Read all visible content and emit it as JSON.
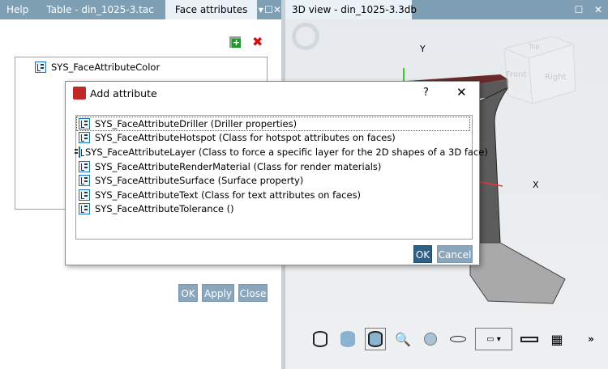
{
  "left_panel": {
    "tabs": [
      {
        "label": "Help"
      },
      {
        "label": "Table - din_1025-3.tac"
      },
      {
        "label": "Face attributes",
        "active": true
      }
    ],
    "icons": [
      "dropdown-icon",
      "maximize-icon",
      "close-icon"
    ],
    "toolbar": {
      "add_icon": "add-attribute-icon",
      "delete_icon": "delete-icon"
    },
    "attributes": [
      {
        "label": "SYS_FaceAttributeColor"
      }
    ],
    "buttons": {
      "ok": "OK",
      "apply": "Apply",
      "close": "Close"
    }
  },
  "right_panel": {
    "tab": "3D view - din_1025-3.3db",
    "axes": {
      "y": "Y",
      "x": "X"
    },
    "view_cube": {
      "top": "Top",
      "front": "Front",
      "right": "Right"
    },
    "toolbar_more": "»"
  },
  "dialog": {
    "title": "Add attribute",
    "help": "?",
    "close": "✕",
    "items": [
      {
        "label": "SYS_FaceAttributeDriller (Driller properties)",
        "selected": true
      },
      {
        "label": "SYS_FaceAttributeHotspot (Class for hotspot attributes on faces)"
      },
      {
        "label": "SYS_FaceAttributeLayer (Class to force a specific layer for the 2D shapes of a 3D face)"
      },
      {
        "label": "SYS_FaceAttributeRenderMaterial (Class for render materials)"
      },
      {
        "label": "SYS_FaceAttributeSurface (Surface property)"
      },
      {
        "label": "SYS_FaceAttributeText (Class for text attributes on faces)"
      },
      {
        "label": "SYS_FaceAttributeTolerance ()"
      }
    ],
    "ok": "OK",
    "cancel": "Cancel"
  },
  "colors": {
    "tabbar": "#7f9fb4",
    "button": "#8aa6bd",
    "ok_button": "#2e5f86",
    "flange_top": "#6b2a2a"
  }
}
